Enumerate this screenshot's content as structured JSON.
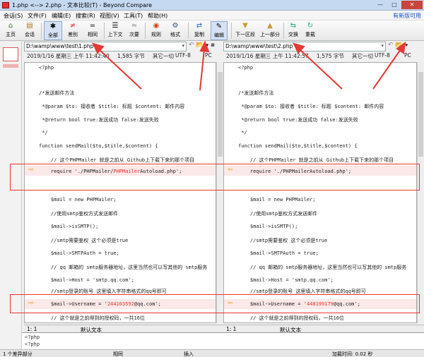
{
  "window": {
    "title": "1.php <--> 2.php - 文本比较(T) - Beyond Compare",
    "min": "—",
    "max": "□",
    "close": "✕"
  },
  "menu": {
    "items": [
      "会话(S)",
      "文件(F)",
      "编辑(E)",
      "搜索(R)",
      "视图(V)",
      "工具(T)",
      "帮助(H)"
    ],
    "new_version": "有新版可用"
  },
  "toolbar": {
    "buttons": [
      {
        "label": "主页",
        "icon": "home-icon"
      },
      {
        "label": "会话",
        "icon": "session-icon"
      },
      {
        "label": "全部",
        "icon": "all-icon"
      },
      {
        "label": "差别",
        "icon": "diff-icon"
      },
      {
        "label": "相同",
        "icon": "same-icon"
      },
      {
        "label": "上下文",
        "icon": "context-icon"
      },
      {
        "label": "次要",
        "icon": "minor-icon"
      },
      {
        "label": "规则",
        "icon": "rules-icon"
      },
      {
        "label": "格式",
        "icon": "format-icon"
      },
      {
        "label": "复制",
        "icon": "copy-icon"
      },
      {
        "label": "编辑",
        "icon": "edit-icon"
      },
      {
        "label": "下一区段",
        "icon": "next-section-icon"
      },
      {
        "label": "上一部分",
        "icon": "prev-section-icon"
      },
      {
        "label": "交换",
        "icon": "swap-icon"
      },
      {
        "label": "重载",
        "icon": "reload-icon"
      }
    ]
  },
  "left": {
    "path": "D:\\wamp\\www\\test\\1.php",
    "date": "2019/1/16 星期三 上午 11:42:40",
    "bytes": "1,585 字节",
    "other": "其它一切",
    "encoding": "UTF-8",
    "line_ending": "PC"
  },
  "right": {
    "path": "D:\\wamp\\www\\test\\2.php",
    "date": "2019/1/16 星期三 上午 11:42:57",
    "bytes": "1,575 字节",
    "other": "其它一切",
    "encoding": "UTF-8",
    "line_ending": "PC"
  },
  "code": {
    "l1": "<?php",
    "l2": "/*发送邮件方法",
    "l3": " *@param $to: 接收者 $title: 标题 $content: 邮件内容",
    "l4": " *@return bool true:发送成功 false:发送失败",
    "l5": " */",
    "l6": "function sendMail($to,$title,$content) {",
    "l7": "    // 这个PHPMailer 就是之前从 Github上下载下来的那个项目",
    "l8_left_a": "    require './PHPMailer/",
    "l8_left_b": "PHPMailer",
    "l8_left_c": "Autoload.php';",
    "l8_right": "    require './PHPMailerAutoload.php';",
    "l9": "    $mail = new PHPMailer;",
    "l10": "    //使用smtp鉴权方式发送邮件",
    "l11": "    $mail->isSMTP();",
    "l12": "    //smtp需要鉴权 这个必须是true",
    "l13": "    $mail->SMTPAuth = true;",
    "l14": "    // qq 邮箱的 smtp服务器地址，这里当然也可以写其他的 smtp服务",
    "l15": "    $mail->Host = 'smtp.qq.com';",
    "l16": "    //smtp登录的账号 这里填入字符串格式的qq号即可",
    "l17_a": "    $mail->Username = '",
    "l17_left_num": "244103592",
    "l17_right_num": "448199179",
    "l17_c": "@qq.com';",
    "l18": "    // 这个就是之前得到的授权码，一共16位"
  },
  "status": {
    "left_pos": "1: 1",
    "left_mode": "默认文本",
    "right_pos": "1: 1",
    "right_mode": "默认文本"
  },
  "bottom": {
    "line1": "<?php",
    "line2": "<?php"
  },
  "statusbar": {
    "diff": "1 个差异部分",
    "same": "相同",
    "insert": "插入",
    "load_time": "加载时间: 0.02 秒"
  }
}
